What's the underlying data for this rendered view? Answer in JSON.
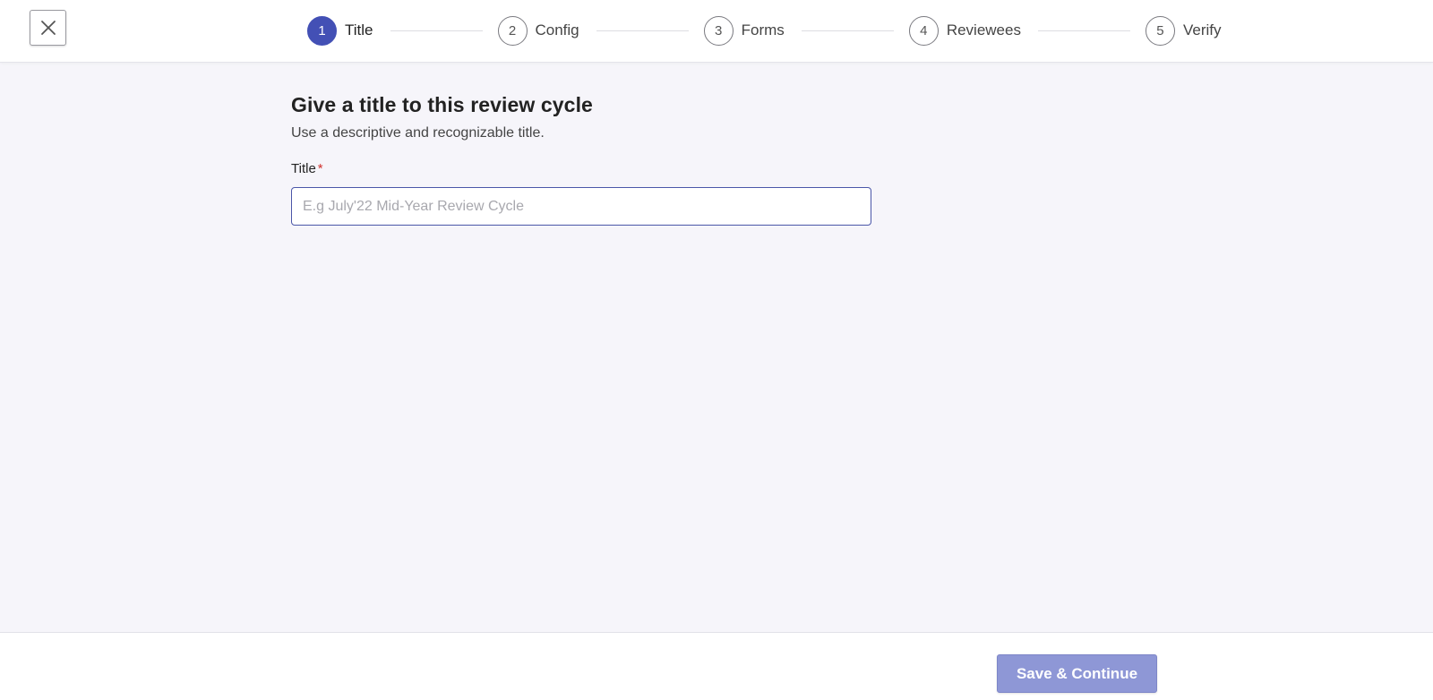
{
  "header": {
    "close_icon": "close-icon",
    "steps": [
      {
        "number": "1",
        "label": "Title",
        "active": true
      },
      {
        "number": "2",
        "label": "Config",
        "active": false
      },
      {
        "number": "3",
        "label": "Forms",
        "active": false
      },
      {
        "number": "4",
        "label": "Reviewees",
        "active": false
      },
      {
        "number": "5",
        "label": "Verify",
        "active": false
      }
    ]
  },
  "main": {
    "heading": "Give a title to this review cycle",
    "subheading": "Use a descriptive and recognizable title.",
    "title_field": {
      "label": "Title",
      "required_mark": "*",
      "value": "",
      "placeholder": "E.g July'22 Mid-Year Review Cycle"
    }
  },
  "footer": {
    "save_label": "Save & Continue"
  },
  "colors": {
    "accent": "#4350b5",
    "button_disabled": "#8e97d6",
    "required": "#d0312d",
    "background": "#f6f5fa"
  }
}
